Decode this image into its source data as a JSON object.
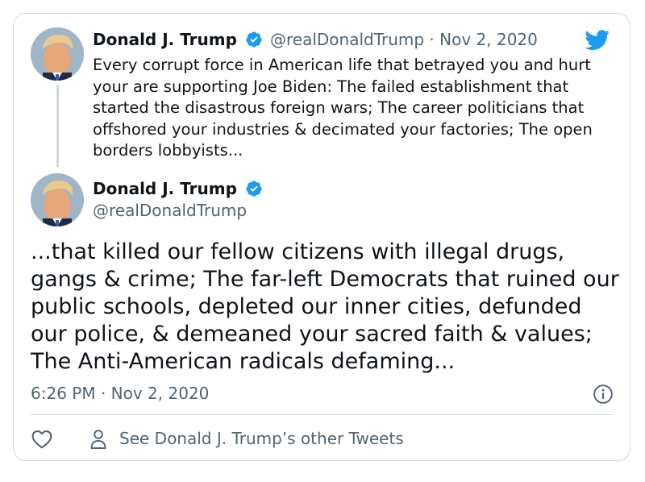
{
  "tweet_parent": {
    "author_name": "Donald J. Trump",
    "handle_and_date": "@realDonaldTrump · Nov 2, 2020",
    "text": "Every corrupt force in American life that betrayed you and hurt your are supporting Joe Biden: The failed establishment that started the disastrous foreign wars; The career politicians that offshored your industries & decimated your factories; The open borders lobbyists..."
  },
  "tweet_main": {
    "author_name": "Donald J. Trump",
    "handle": "@realDonaldTrump",
    "text": "...that killed our fellow citizens with illegal drugs, gangs & crime; The far-left Democrats that ruined our public schools, depleted our inner cities, defunded our police, & demeaned your sacred faith & values; The Anti-American radicals defaming...",
    "timestamp": "6:26 PM · Nov 2, 2020"
  },
  "footer": {
    "other_tweets_label": "See Donald J. Trump’s other Tweets"
  },
  "colors": {
    "brand_blue": "#1d9bf0",
    "text_primary": "#0f1419",
    "text_secondary": "#536471",
    "border": "#cfd9de"
  },
  "icons": {
    "verified": "verified-badge-icon",
    "twitter": "twitter-bird-icon",
    "info": "info-icon",
    "like": "heart-icon",
    "profile": "person-icon"
  }
}
